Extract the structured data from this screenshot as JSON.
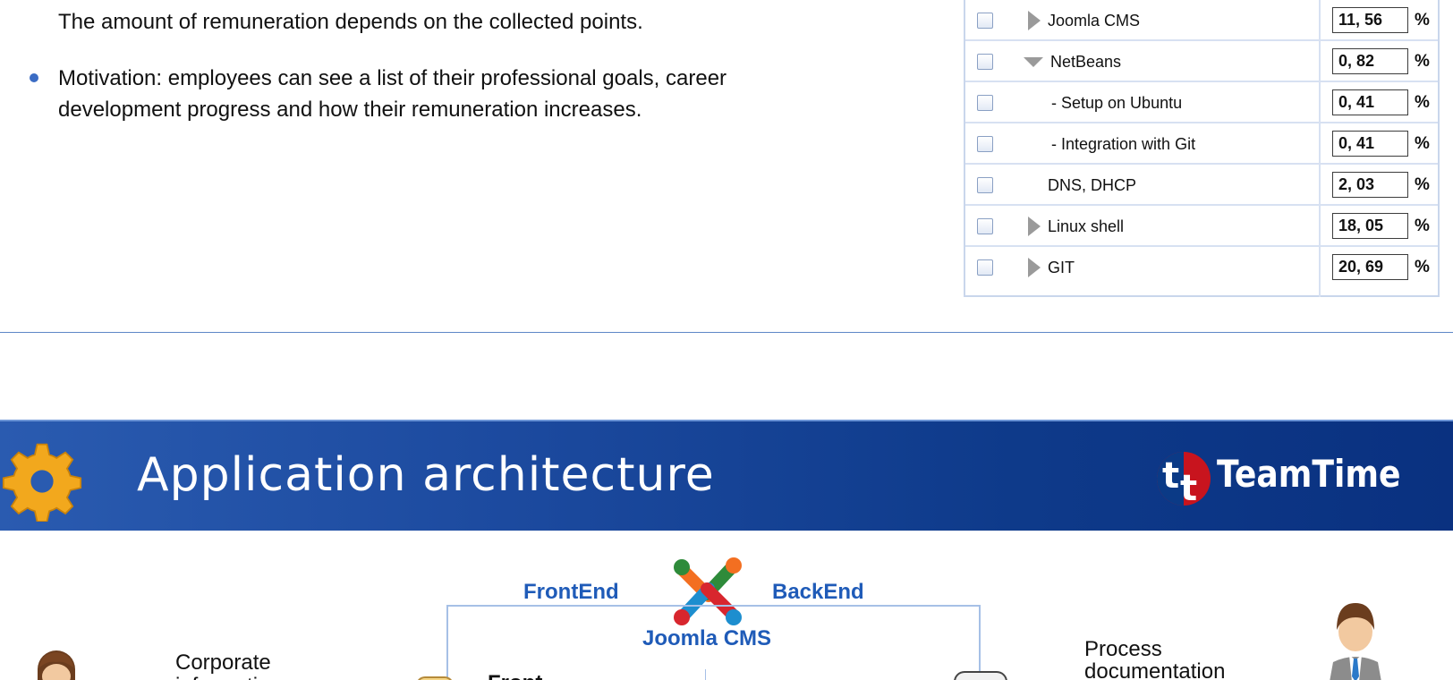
{
  "intro": {
    "continuation": "The amount of remuneration depends on the collected points.",
    "motivation": "Motivation: employees can see a list of their professional goals, career development progress and how their remuneration increases."
  },
  "skills": {
    "rows": [
      {
        "label": "Joomla CMS",
        "value": "11, 56",
        "unit": "%",
        "arrow": "collapsed"
      },
      {
        "label": "NetBeans",
        "value": "0, 82",
        "unit": "%",
        "arrow": "expanded"
      },
      {
        "label": "- Setup on Ubuntu",
        "value": "0, 41",
        "unit": "%",
        "arrow": "none"
      },
      {
        "label": "- Integration with Git",
        "value": "0, 41",
        "unit": "%",
        "arrow": "none"
      },
      {
        "label": "DNS, DHCP",
        "value": "2, 03",
        "unit": "%",
        "arrow": "none"
      },
      {
        "label": "Linux shell",
        "value": "18, 05",
        "unit": "%",
        "arrow": "collapsed"
      },
      {
        "label": "GIT",
        "value": "20, 69",
        "unit": "%",
        "arrow": "collapsed"
      }
    ]
  },
  "banner": {
    "title": "Application architecture",
    "brand": "TeamTime"
  },
  "architecture": {
    "frontend": "FrontEnd",
    "backend": "BackEnd",
    "cms": "Joomla CMS",
    "frontend_partial": "Front",
    "corporate_line1": "Corporate",
    "corporate_line2": "information",
    "process_line1": "Process",
    "process_line2": "documentation"
  },
  "colors": {
    "accent": "#1f5bb8",
    "banner": "#1c4a9f",
    "gear": "#f2a81d"
  }
}
